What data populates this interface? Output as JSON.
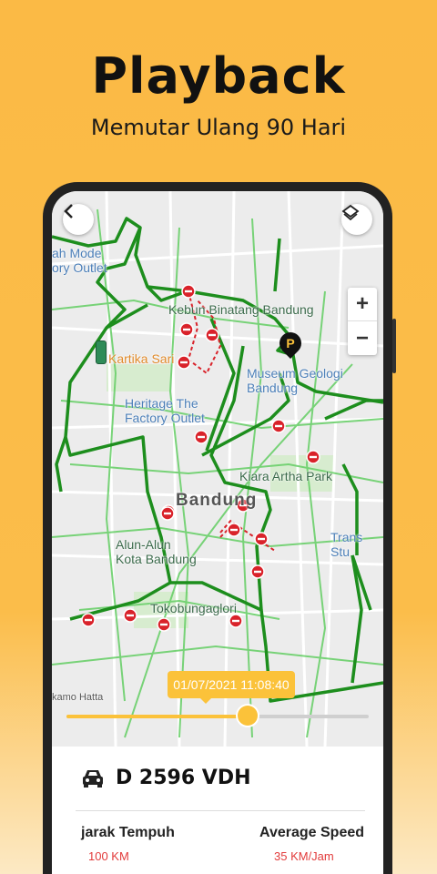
{
  "hero": {
    "title": "Playback",
    "subtitle": "Memutar Ulang 90 Hari"
  },
  "map": {
    "labels": {
      "fashion_outlet": "ah Mode\nory Outlet",
      "kebun_binatang": "Kebun Binatang Bandung",
      "kartika_sari": "Kartika Sari",
      "museum": "Museum Geologi\nBandung",
      "heritage": "Heritage The\nFactory Outlet",
      "kiara": "Kiara Artha Park",
      "city": "Bandung",
      "trans": "Trans Stu",
      "alun_alun": "Alun-Alun\nKota Bandung",
      "toko": "Tokobungaglori",
      "hatta": "kamo Hatta"
    },
    "zoom_in": "+",
    "zoom_out": "−",
    "parking_marker": "P"
  },
  "playback": {
    "timestamp": "01/07/2021 11:08:40",
    "progress": 0.6
  },
  "vehicle": {
    "plate": "D 2596 VDH"
  },
  "stats": {
    "distance_label": "jarak Tempuh",
    "distance_value": "100 KM",
    "speed_label": "Average Speed",
    "speed_value": "35 KM/Jam"
  },
  "colors": {
    "accent": "#FBC23A",
    "route": "#1D8E1D",
    "stop": "#D9222A",
    "value_text": "#E23B3B"
  },
  "icons": {
    "back": "chevron-left-icon",
    "layers": "layers-icon",
    "car": "car-icon",
    "stop": "no-entry-icon"
  }
}
